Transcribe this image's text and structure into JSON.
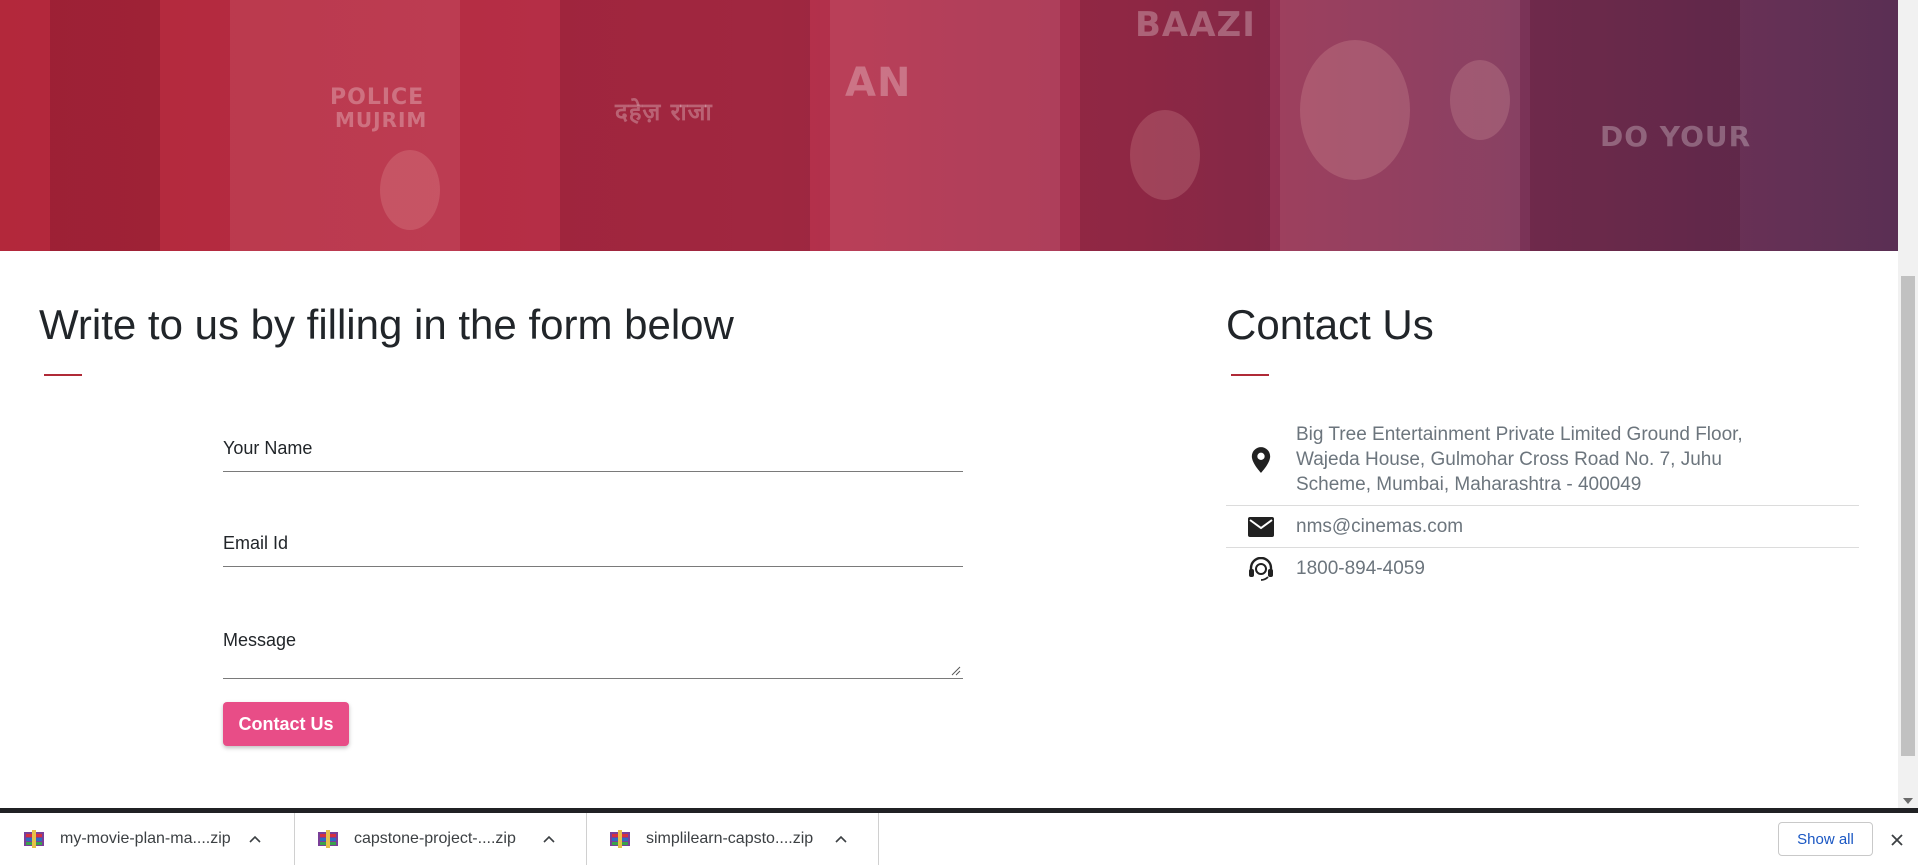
{
  "hero": {
    "poster_texts": [
      "POLICE",
      "MUJRIM",
      "दहेज़ राजा",
      "BAAZI",
      "AN",
      "DO YOUR"
    ]
  },
  "form": {
    "title": "Write to us by filling in the form below",
    "name_label": "Your Name",
    "email_label": "Email Id",
    "message_label": "Message",
    "submit_label": "Contact Us"
  },
  "contact": {
    "title": "Contact Us",
    "address": "Big Tree Entertainment Private Limited Ground Floor, Wajeda House, Gulmohar Cross Road No. 7, Juhu Scheme, Mumbai, Maharashtra - 400049",
    "email": "nms@cinemas.com",
    "phone": "1800-894-4059",
    "icons": [
      "location-pin-icon",
      "mail-icon",
      "headset-icon"
    ]
  },
  "downloads": {
    "items": [
      {
        "name": "my-movie-plan-ma....zip"
      },
      {
        "name": "capstone-project-....zip"
      },
      {
        "name": "simplilearn-capsto....zip"
      }
    ],
    "show_all_label": "Show all"
  },
  "colors": {
    "accent": "#b02a37",
    "button": "#e84d87",
    "hero_start": "#b3283b",
    "hero_end": "#5a2f54"
  }
}
